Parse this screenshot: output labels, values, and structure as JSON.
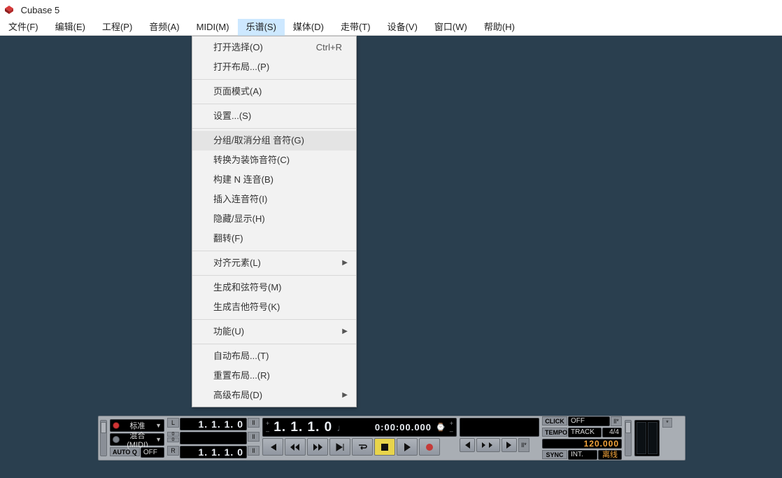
{
  "title": "Cubase 5",
  "menubar": [
    {
      "label": "文件(F)",
      "active": false
    },
    {
      "label": "编辑(E)",
      "active": false
    },
    {
      "label": "工程(P)",
      "active": false
    },
    {
      "label": "音频(A)",
      "active": false
    },
    {
      "label": "MIDI(M)",
      "active": false
    },
    {
      "label": "乐谱(S)",
      "active": true
    },
    {
      "label": "媒体(D)",
      "active": false
    },
    {
      "label": "走带(T)",
      "active": false
    },
    {
      "label": "设备(V)",
      "active": false
    },
    {
      "label": "窗口(W)",
      "active": false
    },
    {
      "label": "帮助(H)",
      "active": false
    }
  ],
  "dropdown": {
    "groups": [
      [
        {
          "label": "打开选择(O)",
          "shortcut": "Ctrl+R",
          "sub": false
        },
        {
          "label": "打开布局...(P)",
          "sub": false
        }
      ],
      [
        {
          "label": "页面模式(A)",
          "sub": false
        }
      ],
      [
        {
          "label": "设置...(S)",
          "sub": false
        }
      ],
      [
        {
          "label": "分组/取消分组 音符(G)",
          "sub": false,
          "hover": true
        },
        {
          "label": "转换为装饰音符(C)",
          "sub": false
        },
        {
          "label": "构建 N 连音(B)",
          "sub": false
        },
        {
          "label": "插入连音符(I)",
          "sub": false
        },
        {
          "label": "隐藏/显示(H)",
          "sub": false
        },
        {
          "label": "翻转(F)",
          "sub": false
        }
      ],
      [
        {
          "label": "对齐元素(L)",
          "sub": true
        }
      ],
      [
        {
          "label": "生成和弦符号(M)",
          "sub": false
        },
        {
          "label": "生成吉他符号(K)",
          "sub": false
        }
      ],
      [
        {
          "label": "功能(U)",
          "sub": true
        }
      ],
      [
        {
          "label": "自动布局...(T)",
          "sub": false
        },
        {
          "label": "重置布局...(R)",
          "sub": false
        },
        {
          "label": "高级布局(D)",
          "sub": true
        }
      ]
    ]
  },
  "transport": {
    "performance_label": "ll*",
    "dropdown1": "标准",
    "dropdown2": "混合(MIDI)",
    "autoq_label": "AUTO Q",
    "autoq_value": "OFF",
    "loc_L": "L",
    "loc_R": "R",
    "locator_in": "1. 1. 1.  0",
    "locator_out": "1. 1. 1.  0",
    "punch_in": "ll",
    "punch_out": "ll",
    "main_time": "1. 1. 1.   0",
    "sub_time": "0:00:00.000",
    "pre_label": "0",
    "post_label": "0",
    "markers_arrange": "ll*",
    "click_label": "CLICK",
    "click_value": "OFF",
    "tempo_label": "TEMPO",
    "tempo_mode": "TRACK",
    "signature": "4/4",
    "tempo_value": "120.000",
    "sync_label": "SYNC",
    "sync_mode": "INT.",
    "sync_status": "离线"
  }
}
